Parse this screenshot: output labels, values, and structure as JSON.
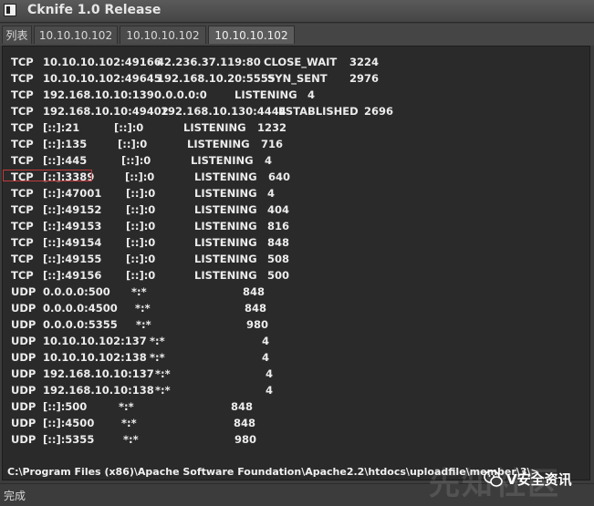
{
  "window": {
    "title": "Cknife 1.0 Release"
  },
  "tabs": [
    {
      "label": "列表"
    },
    {
      "label": "10.10.10.102"
    },
    {
      "label": "10.10.10.102"
    },
    {
      "label": "10.10.10.102"
    }
  ],
  "netstat": [
    [
      "TCP",
      "10.10.10.102:49166",
      "42.236.37.119:80",
      "CLOSE_WAIT",
      "3224"
    ],
    [
      "TCP",
      "10.10.10.102:49645",
      "192.168.10.20:5555",
      "SYN_SENT",
      "2976"
    ],
    [
      "TCP",
      "192.168.10.10:139",
      "0.0.0.0:0",
      "LISTENING",
      "4"
    ],
    [
      "TCP",
      "192.168.10.10:49402",
      "192.168.10.130:4444",
      "ESTABLISHED",
      "2696"
    ],
    [
      "TCP",
      "[::]:21",
      "[::]:0",
      "LISTENING",
      "1232"
    ],
    [
      "TCP",
      "[::]:135",
      "[::]:0",
      "LISTENING",
      "716"
    ],
    [
      "TCP",
      "[::]:445",
      "[::]:0",
      "LISTENING",
      "4"
    ],
    [
      "TCP",
      "[::]:3389",
      "[::]:0",
      "LISTENING",
      "640"
    ],
    [
      "TCP",
      "[::]:47001",
      "[::]:0",
      "LISTENING",
      "4"
    ],
    [
      "TCP",
      "[::]:49152",
      "[::]:0",
      "LISTENING",
      "404"
    ],
    [
      "TCP",
      "[::]:49153",
      "[::]:0",
      "LISTENING",
      "816"
    ],
    [
      "TCP",
      "[::]:49154",
      "[::]:0",
      "LISTENING",
      "848"
    ],
    [
      "TCP",
      "[::]:49155",
      "[::]:0",
      "LISTENING",
      "508"
    ],
    [
      "TCP",
      "[::]:49156",
      "[::]:0",
      "LISTENING",
      "500"
    ],
    [
      "UDP",
      "0.0.0.0:500",
      "*:*",
      "",
      "848"
    ],
    [
      "UDP",
      "0.0.0.0:4500",
      "*:*",
      "",
      "848"
    ],
    [
      "UDP",
      "0.0.0.0:5355",
      "*:*",
      "",
      "980"
    ],
    [
      "UDP",
      "10.10.10.102:137",
      "*:*",
      "",
      "4"
    ],
    [
      "UDP",
      "10.10.10.102:138",
      "*:*",
      "",
      "4"
    ],
    [
      "UDP",
      "192.168.10.10:137",
      "*:*",
      "",
      "4"
    ],
    [
      "UDP",
      "192.168.10.10:138",
      "*:*",
      "",
      "4"
    ],
    [
      "UDP",
      "[::]:500",
      "*:*",
      "",
      "848"
    ],
    [
      "UDP",
      "[::]:4500",
      "*:*",
      "",
      "848"
    ],
    [
      "UDP",
      "[::]:5355",
      "*:*",
      "",
      "980"
    ]
  ],
  "command_line": "C:\\Program Files (x86)\\Apache Software Foundation\\Apache2.2\\htdocs\\uploadfile\\member\\3\\>",
  "status": {
    "text": "完成"
  },
  "watermark": {
    "faint": "先知社区",
    "brand": "V安全资讯"
  }
}
